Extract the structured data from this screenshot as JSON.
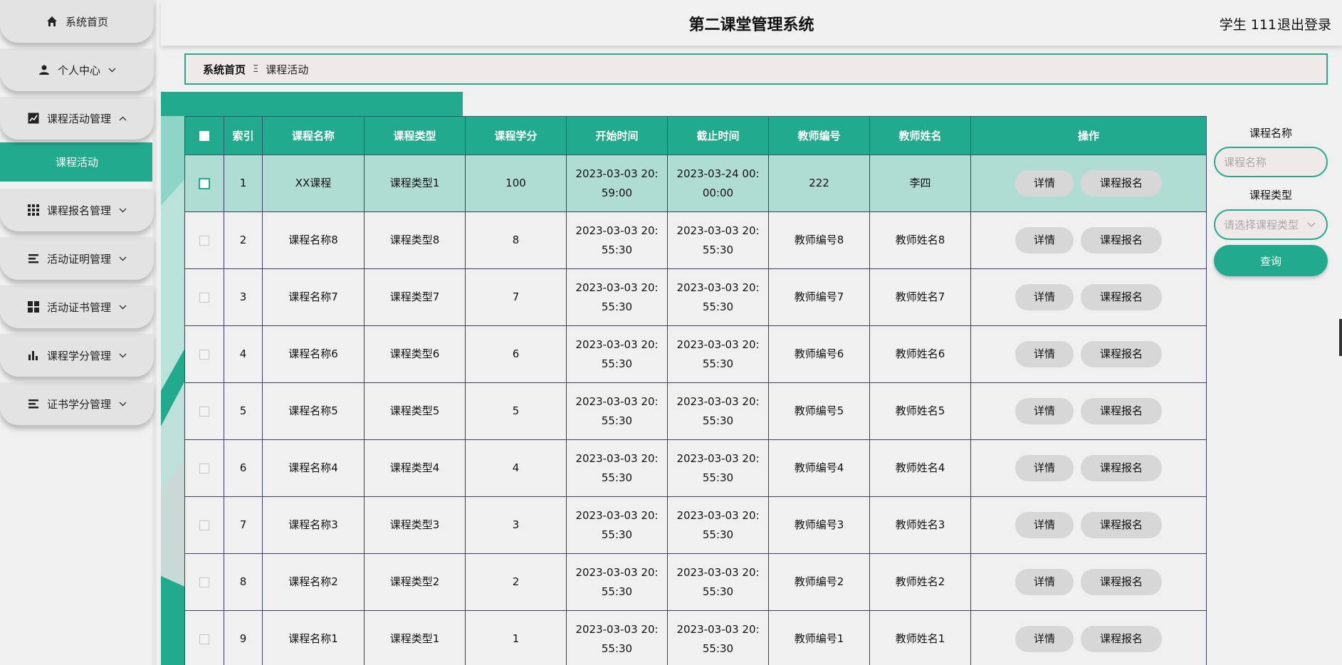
{
  "header": {
    "title": "第二课堂管理系统",
    "user": "学生 111",
    "logout": "退出登录"
  },
  "sidebar": {
    "items": [
      {
        "label": "系统首页",
        "icon": "home-icon"
      },
      {
        "label": "个人中心",
        "icon": "user-icon"
      },
      {
        "label": "课程活动管理",
        "icon": "line-chart-icon"
      },
      {
        "label": "课程报名管理",
        "icon": "grid-icon"
      },
      {
        "label": "活动证明管理",
        "icon": "list-icon"
      },
      {
        "label": "活动证书管理",
        "icon": "tiles-icon"
      },
      {
        "label": "课程学分管理",
        "icon": "bar-chart-icon"
      },
      {
        "label": "证书学分管理",
        "icon": "list-icon"
      }
    ],
    "active_sub": "课程活动"
  },
  "breadcrumb": {
    "home": "系统首页",
    "separator": "Ξ",
    "current": "课程活动"
  },
  "table": {
    "columns": [
      "索引",
      "课程名称",
      "课程类型",
      "课程学分",
      "开始时间",
      "截止时间",
      "教师编号",
      "教师姓名",
      "操作"
    ],
    "rows": [
      {
        "index": "1",
        "name": "XX课程",
        "type": "课程类型1",
        "credit": "100",
        "start": "2023-03-03 20:59:00",
        "end": "2023-03-24 00:00:00",
        "teacher_no": "222",
        "teacher_name": "李四"
      },
      {
        "index": "2",
        "name": "课程名称8",
        "type": "课程类型8",
        "credit": "8",
        "start": "2023-03-03 20:55:30",
        "end": "2023-03-03 20:55:30",
        "teacher_no": "教师编号8",
        "teacher_name": "教师姓名8"
      },
      {
        "index": "3",
        "name": "课程名称7",
        "type": "课程类型7",
        "credit": "7",
        "start": "2023-03-03 20:55:30",
        "end": "2023-03-03 20:55:30",
        "teacher_no": "教师编号7",
        "teacher_name": "教师姓名7"
      },
      {
        "index": "4",
        "name": "课程名称6",
        "type": "课程类型6",
        "credit": "6",
        "start": "2023-03-03 20:55:30",
        "end": "2023-03-03 20:55:30",
        "teacher_no": "教师编号6",
        "teacher_name": "教师姓名6"
      },
      {
        "index": "5",
        "name": "课程名称5",
        "type": "课程类型5",
        "credit": "5",
        "start": "2023-03-03 20:55:30",
        "end": "2023-03-03 20:55:30",
        "teacher_no": "教师编号5",
        "teacher_name": "教师姓名5"
      },
      {
        "index": "6",
        "name": "课程名称4",
        "type": "课程类型4",
        "credit": "4",
        "start": "2023-03-03 20:55:30",
        "end": "2023-03-03 20:55:30",
        "teacher_no": "教师编号4",
        "teacher_name": "教师姓名4"
      },
      {
        "index": "7",
        "name": "课程名称3",
        "type": "课程类型3",
        "credit": "3",
        "start": "2023-03-03 20:55:30",
        "end": "2023-03-03 20:55:30",
        "teacher_no": "教师编号3",
        "teacher_name": "教师姓名3"
      },
      {
        "index": "8",
        "name": "课程名称2",
        "type": "课程类型2",
        "credit": "2",
        "start": "2023-03-03 20:55:30",
        "end": "2023-03-03 20:55:30",
        "teacher_no": "教师编号2",
        "teacher_name": "教师姓名2"
      },
      {
        "index": "9",
        "name": "课程名称1",
        "type": "课程类型1",
        "credit": "1",
        "start": "2023-03-03 20:55:30",
        "end": "2023-03-03 20:55:30",
        "teacher_no": "教师编号1",
        "teacher_name": "教师姓名1"
      }
    ],
    "actions": {
      "detail": "详情",
      "enroll": "课程报名"
    }
  },
  "search": {
    "name_label": "课程名称",
    "name_placeholder": "课程名称",
    "type_label": "课程类型",
    "type_placeholder": "请选择课程类型",
    "query": "查询"
  },
  "colors": {
    "accent": "#22aa8e",
    "highlight_row": "#b0ddd3",
    "background": "#f1f0f0"
  }
}
